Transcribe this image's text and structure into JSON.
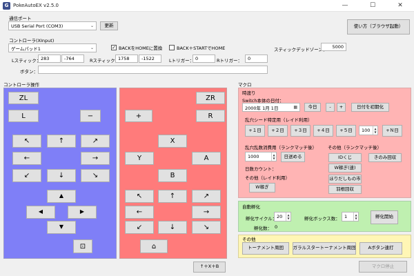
{
  "window": {
    "title": "PokeAutoEX v2.5.0",
    "app_icon": "G",
    "minimize": "—",
    "maximize": "☐",
    "close": "✕"
  },
  "comm": {
    "group_label": "通信ポート",
    "port_value": "USB Serial Port (COM3)",
    "update_button": "更新",
    "help_button": "使い方（ブラウザ起動）"
  },
  "controller": {
    "group_label": "コントローラ(XInput)",
    "device_value": "ゲームパッド1",
    "back_home_label": "BACKをHOMEに置換",
    "back_start_label": "BACK＋STARTでHOME",
    "deadzone_label": "スティックデッドゾーン：",
    "deadzone_value": "5000",
    "lstick_label": "Lスティック：",
    "lstick_x": "283",
    "lstick_y": "-764",
    "rstick_label": "Rスティック：",
    "rstick_x": "1758",
    "rstick_y": "-1522",
    "ltrigger_label": "Lトリガー：",
    "ltrigger_value": "0",
    "rtrigger_label": "Rトリガー：",
    "rtrigger_value": "0",
    "buttons_label": "ボタン：",
    "buttons_value": ""
  },
  "manual": {
    "group_label": "コントローラ操作",
    "zl": "ZL",
    "l": "L",
    "minus": "−",
    "dpad": [
      "↖",
      "↑",
      "↗",
      "←",
      "→",
      "↙",
      "↓",
      "↘"
    ],
    "lstick": [
      "▲",
      "◀",
      "▶",
      "▼"
    ],
    "capture": "⊡",
    "zr": "ZR",
    "r": "R",
    "plus": "+",
    "x": "X",
    "y": "Y",
    "a": "A",
    "b": "B",
    "rdpad": [
      "↖",
      "↑",
      "↗",
      "←",
      "→",
      "↙",
      "↓",
      "↘"
    ],
    "home": "⌂",
    "combo_button": "↑＋X＋B"
  },
  "macro": {
    "group_label": "マクロ",
    "time": {
      "label": "時渡り",
      "date_label": "Switch本体の日付：",
      "date_value": "2000年  1月  1日",
      "today": "今日",
      "minus": "-",
      "plus": "+",
      "init_date": "日付を初期化",
      "seed_label": "乱穴シード特定用（レイド利用）",
      "day_buttons": [
        "+１日",
        "+２日",
        "+３日",
        "+４日",
        "+５日"
      ],
      "n_value": "100",
      "n_button": "+Ｎ日",
      "rank_label": "乱穴乱数消費用（ランクマッチ後）",
      "rank_value": "1000",
      "rank_go": "日送める",
      "day_count_label": "日数カウント：",
      "other_raid_label": "その他（レイド利用）",
      "w_button": "W稼ぎ",
      "other_rank_label": "その他（ランクマッチ後）",
      "id_button": "IDくじ",
      "nuts_button": "きのみ回収",
      "w_fast_button": "W稼ぎ(速)",
      "dig_button": "ほりだしもの市",
      "feather_button": "羽根回収"
    },
    "hatch": {
      "label": "自動孵化",
      "cycle_label": "孵化サイクル：",
      "cycle_value": "20",
      "box_label": "孵化ボックス数：",
      "box_value": "1",
      "count_label": "孵化数：",
      "count_value": "0",
      "start_button": "孵化開始"
    },
    "other": {
      "label": "その他",
      "tournament": "トーナメント周回",
      "galar_tournament": "ガラルスタートーナメント周回",
      "a_button": "Aボタン連打"
    },
    "stop_button": "マクロ停止"
  },
  "colors": {
    "manual_left": "#7f7ff7",
    "manual_right": "#ff7b7b",
    "time_panel": "#ffb4b4",
    "hatch_panel": "#bff0b0",
    "other_panel": "#fff6b5"
  }
}
